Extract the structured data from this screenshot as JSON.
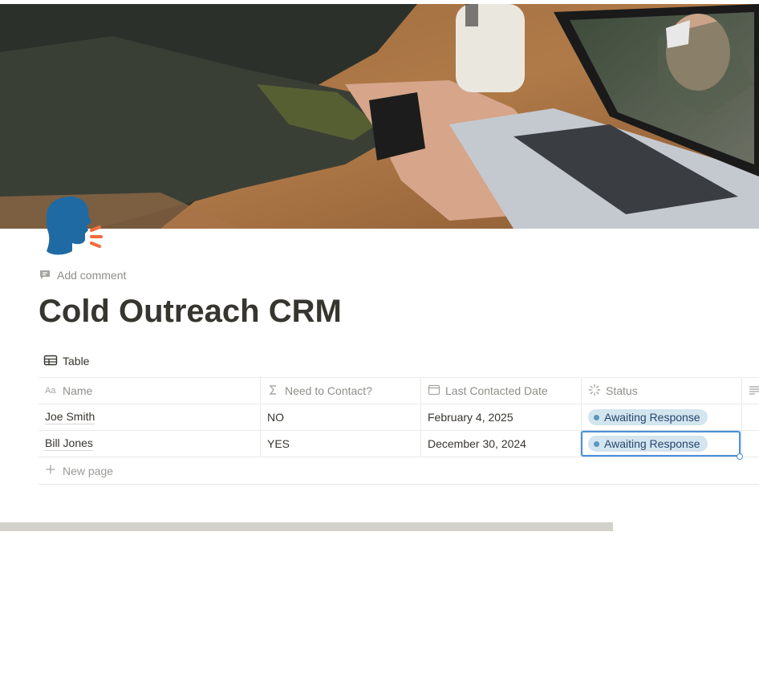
{
  "page": {
    "title": "Cold Outreach CRM",
    "add_comment": "Add comment",
    "icon": "speaking-head-icon"
  },
  "view": {
    "tab_label": "Table",
    "icon": "table-icon"
  },
  "table": {
    "columns": [
      {
        "label": "Name",
        "icon": "text-type-icon"
      },
      {
        "label": "Need to Contact?",
        "icon": "formula-icon"
      },
      {
        "label": "Last Contacted Date",
        "icon": "calendar-icon"
      },
      {
        "label": "Status",
        "icon": "status-icon"
      },
      {
        "label": "",
        "icon": "text-lines-icon"
      }
    ],
    "rows": [
      {
        "name": "Joe Smith",
        "need": "NO",
        "date": "February 4, 2025",
        "status": "Awaiting Response"
      },
      {
        "name": "Bill Jones",
        "need": "YES",
        "date": "December 30, 2024",
        "status": "Awaiting Response"
      }
    ],
    "new_page": "New page"
  },
  "colors": {
    "text": "#37352f",
    "muted": "#8f8e8a",
    "status_pill_bg": "#d3e5ef",
    "status_pill_text": "#28456c",
    "status_dot": "#5b97bd",
    "selection": "#4a90d9"
  }
}
